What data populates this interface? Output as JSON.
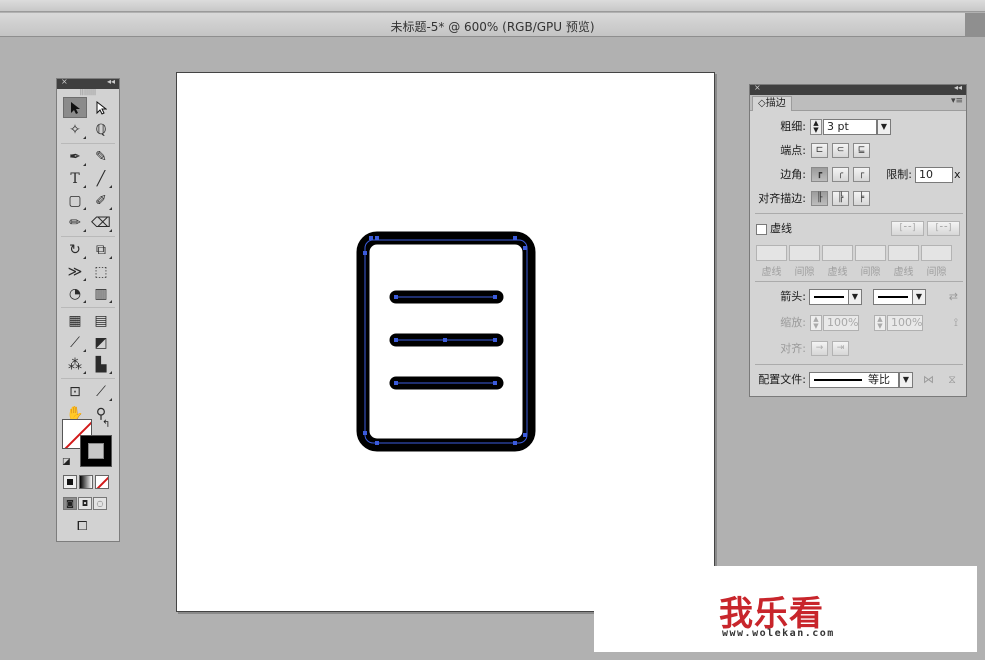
{
  "window": {
    "doc_title": "未标题-5* @ 600% (RGB/GPU 预览)"
  },
  "tools_panel": {
    "close_glyph": "×",
    "collapse_glyph": "◂◂",
    "grip": "||||||||",
    "tools": [
      [
        "selection-tool-icon",
        "direct-selection-tool-icon"
      ],
      [
        "magic-wand-tool-icon",
        "lasso-tool-icon"
      ],
      [
        "pen-tool-icon",
        "curvature-tool-icon"
      ],
      [
        "type-tool-icon",
        "line-segment-tool-icon"
      ],
      [
        "rectangle-tool-icon",
        "paintbrush-tool-icon"
      ],
      [
        "pencil-tool-icon",
        "eraser-tool-icon"
      ],
      [
        "rotate-tool-icon",
        "scale-tool-icon"
      ],
      [
        "width-tool-icon",
        "free-transform-tool-icon"
      ],
      [
        "shape-builder-tool-icon",
        "perspective-grid-tool-icon"
      ],
      [
        "mesh-tool-icon",
        "gradient-tool-icon"
      ],
      [
        "eyedropper-tool-icon",
        "blend-tool-icon"
      ],
      [
        "symbol-sprayer-tool-icon",
        "column-graph-tool-icon"
      ],
      [
        "artboard-tool-icon",
        "slice-tool-icon"
      ],
      [
        "hand-tool-icon",
        "zoom-tool-icon"
      ]
    ]
  },
  "stroke_panel": {
    "close_glyph": "×",
    "collapse_glyph": "◂◂",
    "tab_label": "◇描边",
    "menu_glyph": "▾≡",
    "weight_label": "粗细:",
    "weight_value": "3 pt",
    "cap_label": "端点:",
    "corner_label": "边角:",
    "limit_label": "限制:",
    "limit_value": "10",
    "limit_unit": "x",
    "align_label": "对齐描边:",
    "dashed_label": "虚线",
    "dash_labels": [
      "虚线",
      "间隙",
      "虚线",
      "间隙",
      "虚线",
      "间隙"
    ],
    "arrow_label": "箭头:",
    "scale_label": "缩放:",
    "scale_value_1": "100%",
    "scale_value_2": "100%",
    "align_arrow_label": "对齐:",
    "profile_label": "配置文件:",
    "profile_value": "等比"
  },
  "artwork": {
    "stroke_color": "#000000",
    "anchor_color": "#3b5bdb",
    "lines": 3
  },
  "watermark": {
    "logo": "我乐看",
    "url": "www.wolekan.com"
  }
}
